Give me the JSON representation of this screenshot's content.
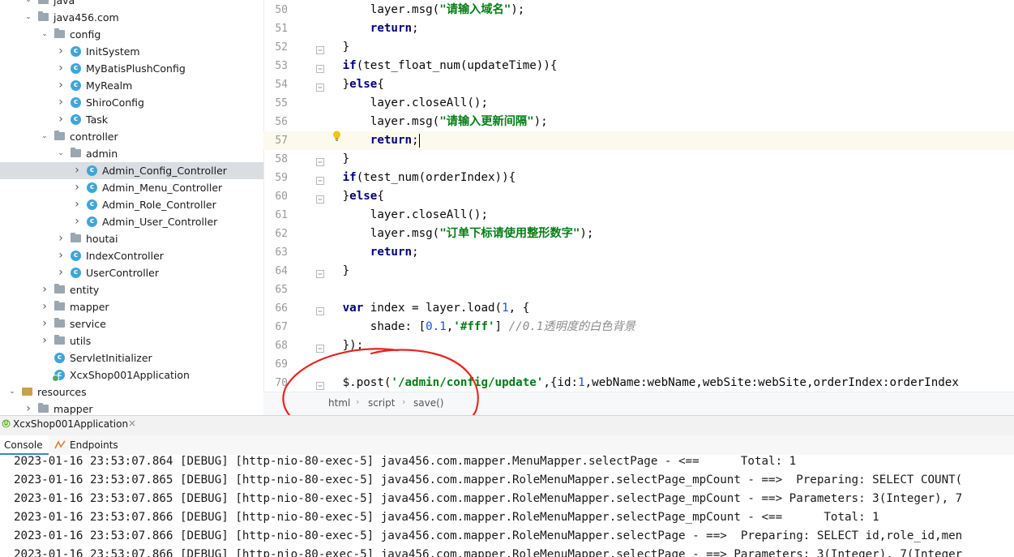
{
  "tree": {
    "rows": [
      {
        "label": "java",
        "icon": "folder",
        "chev": "down"
      },
      {
        "label": "java456.com",
        "icon": "folder",
        "chev": "down"
      },
      {
        "label": "config",
        "icon": "folder",
        "chev": "down"
      },
      {
        "label": "InitSystem",
        "icon": "class",
        "chev": "right"
      },
      {
        "label": "MyBatisPlushConfig",
        "icon": "class",
        "chev": "right"
      },
      {
        "label": "MyRealm",
        "icon": "class",
        "chev": "right"
      },
      {
        "label": "ShiroConfig",
        "icon": "class",
        "chev": "right"
      },
      {
        "label": "Task",
        "icon": "class",
        "chev": "right"
      },
      {
        "label": "controller",
        "icon": "folder",
        "chev": "down"
      },
      {
        "label": "admin",
        "icon": "folder",
        "chev": "down"
      },
      {
        "label": "Admin_Config_Controller",
        "icon": "class",
        "chev": "right",
        "selected": true
      },
      {
        "label": "Admin_Menu_Controller",
        "icon": "class",
        "chev": "right"
      },
      {
        "label": "Admin_Role_Controller",
        "icon": "class",
        "chev": "right"
      },
      {
        "label": "Admin_User_Controller",
        "icon": "class",
        "chev": "right"
      },
      {
        "label": "houtai",
        "icon": "folder",
        "chev": "right"
      },
      {
        "label": "IndexController",
        "icon": "class",
        "chev": "right"
      },
      {
        "label": "UserController",
        "icon": "class",
        "chev": "right"
      },
      {
        "label": "entity",
        "icon": "folder",
        "chev": "right"
      },
      {
        "label": "mapper",
        "icon": "folder",
        "chev": "right"
      },
      {
        "label": "service",
        "icon": "folder",
        "chev": "right"
      },
      {
        "label": "utils",
        "icon": "folder",
        "chev": "right"
      },
      {
        "label": "ServletInitializer",
        "icon": "class",
        "chev": "none"
      },
      {
        "label": "XcxShop001Application",
        "icon": "app",
        "chev": "none"
      },
      {
        "label": "resources",
        "icon": "resources",
        "chev": "down"
      },
      {
        "label": "mapper",
        "icon": "folder",
        "chev": "right"
      }
    ]
  },
  "editor": {
    "lines": [
      {
        "n": "50",
        "code": [
          [
            "    layer.msg(",
            ""
          ],
          [
            "\"请输入域名\"",
            "str"
          ],
          [
            ");",
            ""
          ]
        ]
      },
      {
        "n": "51",
        "code": [
          [
            "    ",
            ""
          ],
          [
            "return",
            "kw"
          ],
          [
            ";",
            ""
          ]
        ]
      },
      {
        "n": "52",
        "code": [
          [
            "}",
            ""
          ]
        ]
      },
      {
        "n": "53",
        "code": [
          [
            "if",
            "kw"
          ],
          [
            "(test_float_num(updateTime)){",
            ""
          ]
        ]
      },
      {
        "n": "54",
        "code": [
          [
            "}",
            ""
          ],
          [
            "else",
            "kw"
          ],
          [
            "{",
            ""
          ]
        ]
      },
      {
        "n": "55",
        "code": [
          [
            "    layer.closeAll();",
            ""
          ]
        ]
      },
      {
        "n": "56",
        "code": [
          [
            "    layer.msg(",
            ""
          ],
          [
            "\"请输入更新间隔\"",
            "str"
          ],
          [
            ");",
            ""
          ]
        ]
      },
      {
        "n": "57",
        "code": [
          [
            "    ",
            ""
          ],
          [
            "return",
            "kw"
          ],
          [
            ";",
            ""
          ]
        ],
        "current": true
      },
      {
        "n": "58",
        "code": [
          [
            "}",
            ""
          ]
        ]
      },
      {
        "n": "59",
        "code": [
          [
            "if",
            "kw"
          ],
          [
            "(test_num(orderIndex)){",
            ""
          ]
        ]
      },
      {
        "n": "60",
        "code": [
          [
            "}",
            ""
          ],
          [
            "else",
            "kw"
          ],
          [
            "{",
            ""
          ]
        ]
      },
      {
        "n": "61",
        "code": [
          [
            "    layer.closeAll();",
            ""
          ]
        ]
      },
      {
        "n": "62",
        "code": [
          [
            "    layer.msg(",
            ""
          ],
          [
            "\"订单下标请使用整形数字\"",
            "str"
          ],
          [
            ");",
            ""
          ]
        ]
      },
      {
        "n": "63",
        "code": [
          [
            "    ",
            ""
          ],
          [
            "return",
            "kw"
          ],
          [
            ";",
            ""
          ]
        ]
      },
      {
        "n": "64",
        "code": [
          [
            "}",
            ""
          ]
        ]
      },
      {
        "n": "65",
        "code": []
      },
      {
        "n": "66",
        "code": [
          [
            "var",
            "kw"
          ],
          [
            " index = layer.load(",
            ""
          ],
          [
            "1",
            "num"
          ],
          [
            ", {",
            ""
          ]
        ]
      },
      {
        "n": "67",
        "code": [
          [
            "    shade: [",
            ""
          ],
          [
            "0.1",
            "num"
          ],
          [
            ",",
            ""
          ],
          [
            "'#fff'",
            "str"
          ],
          [
            "] ",
            ""
          ],
          [
            "//0.1透明度的白色背景",
            "cmt"
          ]
        ]
      },
      {
        "n": "68",
        "code": [
          [
            "});",
            ""
          ]
        ]
      },
      {
        "n": "69",
        "code": []
      },
      {
        "n": "70",
        "code": [
          [
            "$.post(",
            ""
          ],
          [
            "'/admin/config/update'",
            "str"
          ],
          [
            ",{id:",
            ""
          ],
          [
            "1",
            "num"
          ],
          [
            ",webName:webName,webSite:webSite,orderIndex:orderIndex",
            ""
          ]
        ]
      }
    ]
  },
  "breadcrumb": {
    "items": [
      "html",
      "script",
      "save()"
    ]
  },
  "run_tab": {
    "label": "XcxShop001Application",
    "close": "×"
  },
  "tool_tabs": {
    "console": "Console",
    "endpoints": "Endpoints"
  },
  "console": {
    "lines": [
      "2023-01-16 23:53:07.864 [DEBUG] [http-nio-80-exec-5] java456.com.mapper.MenuMapper.selectPage - <==      Total: 1",
      "2023-01-16 23:53:07.865 [DEBUG] [http-nio-80-exec-5] java456.com.mapper.RoleMenuMapper.selectPage_mpCount - ==>  Preparing: SELECT COUNT(",
      "2023-01-16 23:53:07.865 [DEBUG] [http-nio-80-exec-5] java456.com.mapper.RoleMenuMapper.selectPage_mpCount - ==> Parameters: 3(Integer), 7",
      "2023-01-16 23:53:07.866 [DEBUG] [http-nio-80-exec-5] java456.com.mapper.RoleMenuMapper.selectPage_mpCount - <==      Total: 1",
      "2023-01-16 23:53:07.866 [DEBUG] [http-nio-80-exec-5] java456.com.mapper.RoleMenuMapper.selectPage - ==>  Preparing: SELECT id,role_id,men",
      "2023-01-16 23:53:07.866 [DEBUG] [http-nio-80-exec-5] java456.com.mapper.RoleMenuMapper.selectPage - ==> Parameters: 3(Integer), 7(Integer"
    ]
  }
}
